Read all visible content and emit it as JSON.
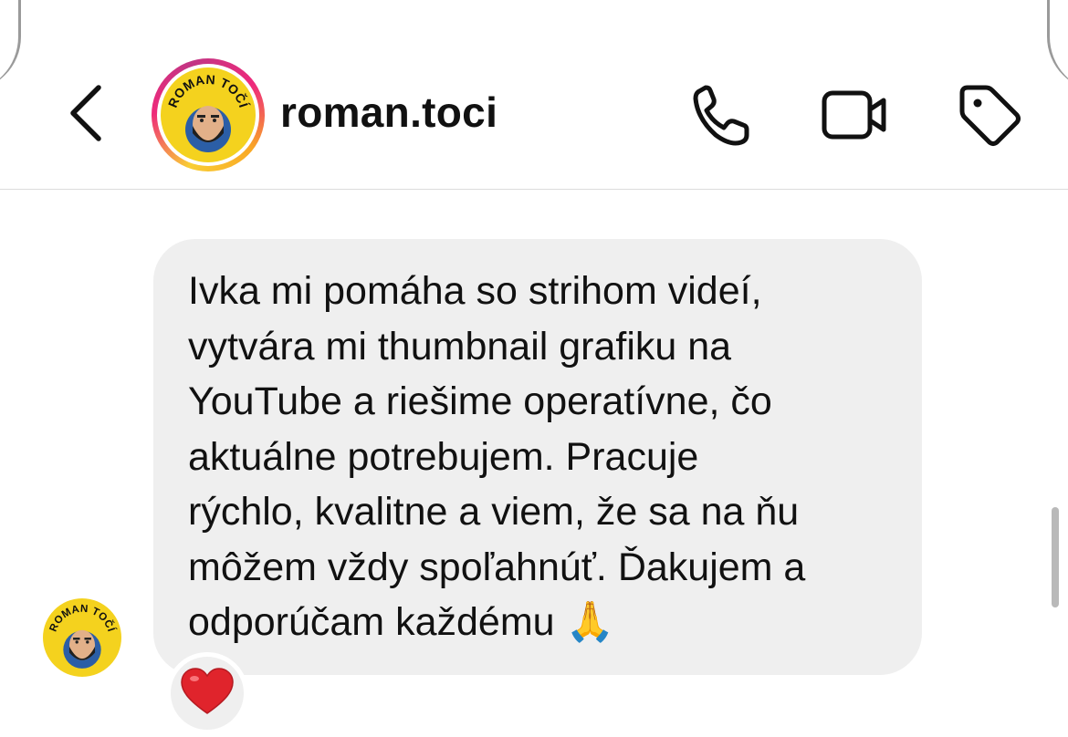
{
  "header": {
    "username": "roman.toci",
    "avatar_text": "ROMAN TOČÍ",
    "icons": {
      "back": "chevron-left-icon",
      "call": "phone-icon",
      "video": "video-camera-icon",
      "tag": "tag-icon"
    }
  },
  "message": {
    "lines": [
      "Ivka mi pomáha so strihom videí,",
      "vytvára mi thumbnail grafiku na",
      "YouTube a riešime operatívne, čo",
      "aktuálne potrebujem. Pracuje",
      "rýchlo, kvalitne a viem, že sa na ňu",
      "môžem vždy spoľahnúť. Ďakujem a",
      "odporúčam každému"
    ],
    "emoji": "🙏",
    "reaction": "❤️"
  },
  "colors": {
    "bubble_bg": "#efefef",
    "avatar_yellow": "#f4d21e",
    "story_ring": [
      "#f9ce34",
      "#ee2a7b",
      "#c13584"
    ],
    "heart": "#e0242c"
  }
}
